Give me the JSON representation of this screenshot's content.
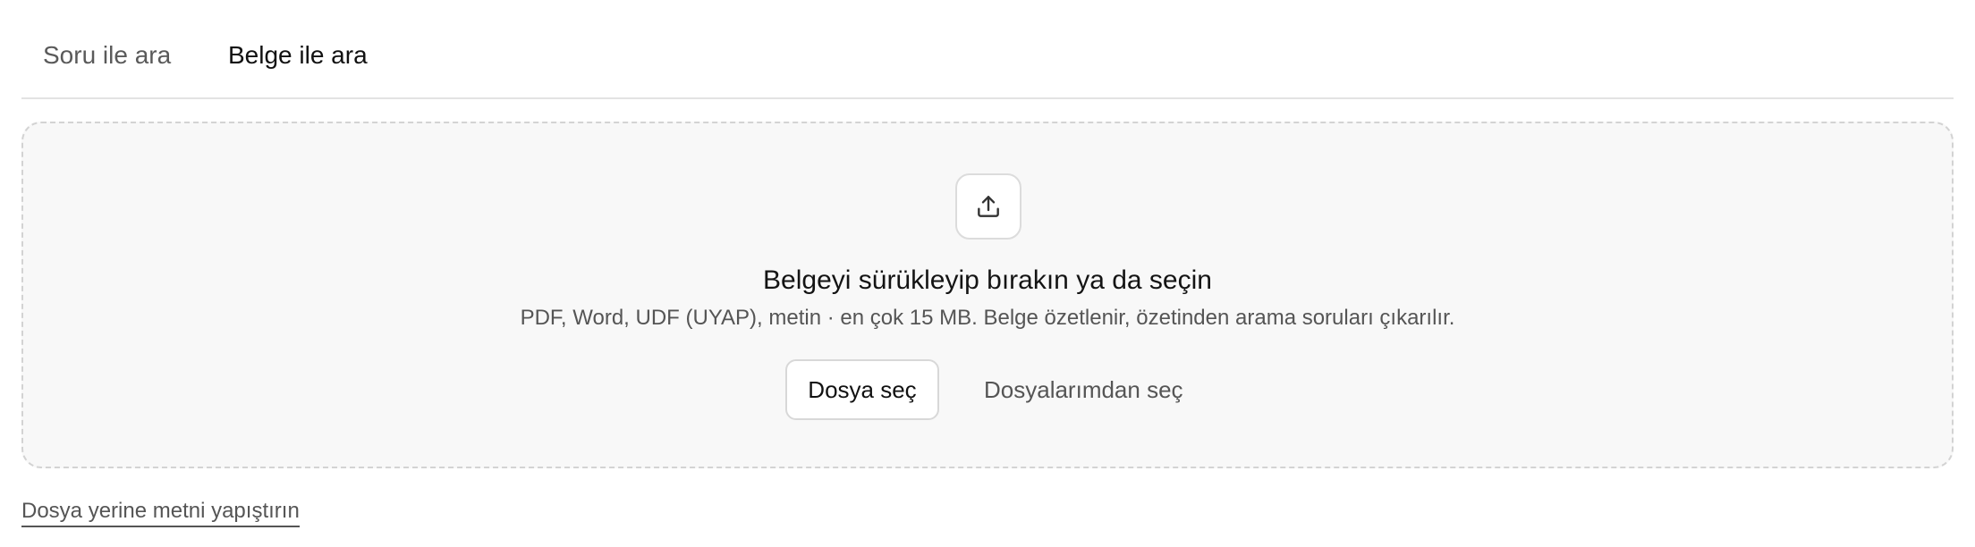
{
  "tabs": [
    {
      "label": "Soru ile ara",
      "active": false
    },
    {
      "label": "Belge ile ara",
      "active": true
    }
  ],
  "dropzone": {
    "icon": "upload-icon",
    "title": "Belgeyi sürükleyip bırakın ya da seçin",
    "subtitle": "PDF, Word, UDF (UYAP), metin · en çok 15 MB. Belge özetlenir, özetinden arama soruları çıkarılır.",
    "choose_file_label": "Dosya seç",
    "choose_from_my_files_label": "Dosyalarımdan seç"
  },
  "paste_text_link": "Dosya yerine metni yapıştırın",
  "colors": {
    "dropzone_bg": "#f8f8f8",
    "dropzone_border": "#d3d3d3",
    "muted_text": "#555555",
    "active_tab_text": "#111111"
  }
}
